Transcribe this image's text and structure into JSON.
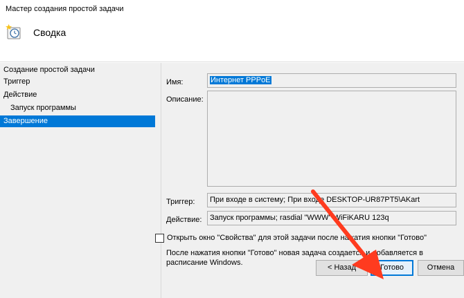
{
  "window": {
    "title": "Мастер создания простой задачи"
  },
  "header": {
    "heading": "Сводка",
    "icon": "clock-wizard-icon"
  },
  "steps": [
    {
      "label": "Создание простой задачи",
      "indent": false,
      "active": false
    },
    {
      "label": "Триггер",
      "indent": false,
      "active": false
    },
    {
      "label": "Действие",
      "indent": false,
      "active": false
    },
    {
      "label": "Запуск программы",
      "indent": true,
      "active": false
    },
    {
      "label": "Завершение",
      "indent": false,
      "active": true
    }
  ],
  "summary": {
    "name_label": "Имя:",
    "name_value": "Интернет PPPoE",
    "description_label": "Описание:",
    "description_value": "",
    "trigger_label": "Триггер:",
    "trigger_value": "При входе в систему; При входе DESKTOP-UR87PT5\\AKart",
    "action_label": "Действие:",
    "action_value": "Запуск программы; rasdial \"WWW\" WiFiKARU 123q"
  },
  "options": {
    "open_properties_label": "Открыть окно \"Свойства\" для этой задачи после нажатия кнопки \"Готово\"",
    "open_properties_checked": false,
    "note": "После нажатия кнопки \"Готово\" новая задача создается и добавляется в расписание Windows."
  },
  "buttons": {
    "back": "< Назад",
    "finish": "Готово",
    "cancel": "Отмена"
  },
  "colors": {
    "accent": "#0078d7",
    "arrow": "#ff3b1f"
  }
}
